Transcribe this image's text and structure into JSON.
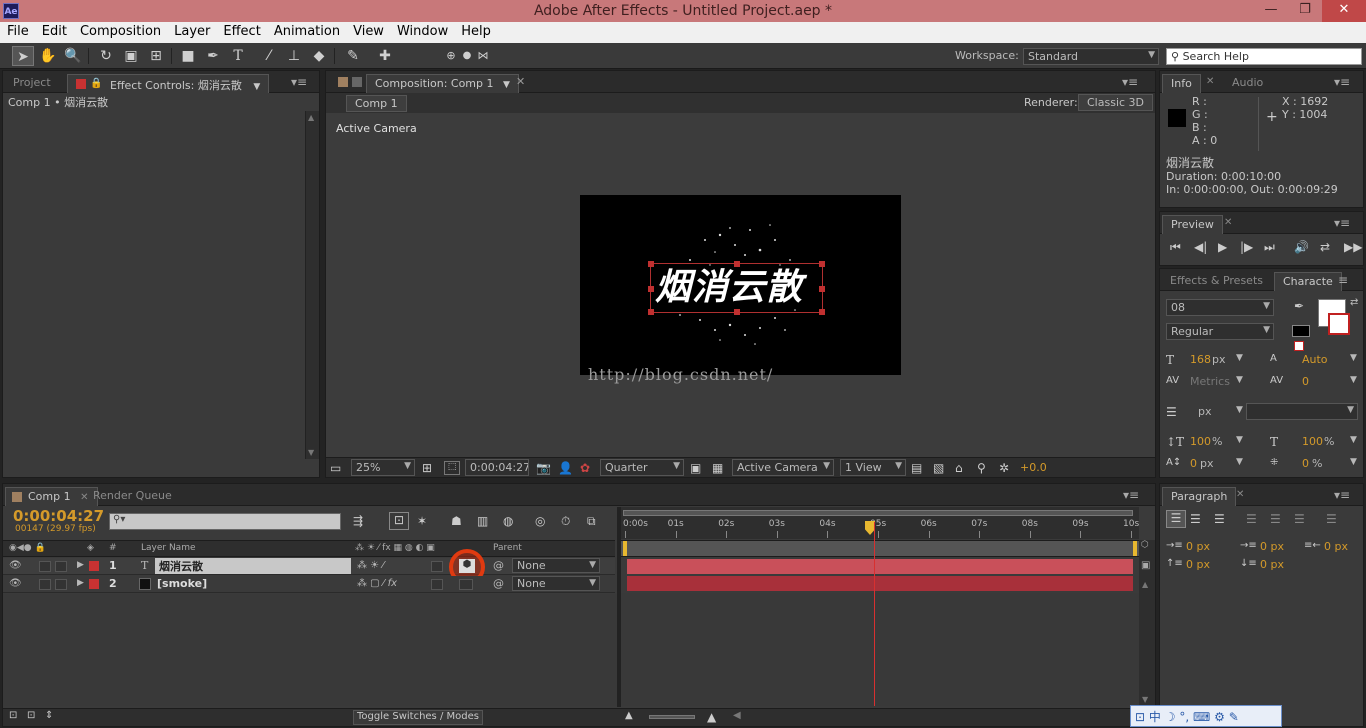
{
  "app": {
    "title": "Adobe After Effects - Untitled Project.aep *",
    "icon": "Ae",
    "min": "—",
    "max": "❐",
    "close": "✕"
  },
  "menu": [
    "File",
    "Edit",
    "Composition",
    "Layer",
    "Effect",
    "Animation",
    "View",
    "Window",
    "Help"
  ],
  "toolbar": {
    "workspace_label": "Workspace:",
    "workspace_value": "Standard",
    "search_placeholder": "Search Help"
  },
  "project_panel": {
    "tab_project": "Project",
    "tab_effect_controls": "Effect Controls: 烟消云散",
    "breadcrumb": "Comp 1 • 烟消云散"
  },
  "comp_panel": {
    "tab": "Composition: Comp 1",
    "comp_button": "Comp 1",
    "renderer_label": "Renderer:",
    "renderer_value": "Classic 3D",
    "view_label": "Active Camera",
    "text_content": "烟消云散",
    "watermark": "http://blog.csdn.net/",
    "zoom": "25%",
    "timecode": "0:00:04:27",
    "resolution": "Quarter",
    "camera": "Active Camera",
    "views": "1 View",
    "exposure": "+0.0"
  },
  "info_panel": {
    "tab_info": "Info",
    "tab_audio": "Audio",
    "r": "R :",
    "g": "G :",
    "b": "B :",
    "a": "A : 0",
    "x": "X : 1692",
    "y": "Y : 1004",
    "layer_name": "烟消云散",
    "duration": "Duration: 0:00:10:00",
    "in_out": "In: 0:00:00:00, Out: 0:00:09:29"
  },
  "preview_panel": {
    "tab": "Preview"
  },
  "character_panel": {
    "tab_effects": "Effects & Presets",
    "tab_character": "Characte",
    "font": "08",
    "style": "Regular",
    "size": "168",
    "size_unit": "px",
    "leading": "Auto",
    "kerning": "Metrics",
    "tracking": "0",
    "stroke_unit": "px",
    "vscale": "100",
    "vscale_unit": "%",
    "hscale": "100",
    "hscale_unit": "%",
    "baseline": "0",
    "baseline_unit": "px",
    "tsume": "0",
    "tsume_unit": "%"
  },
  "paragraph_panel": {
    "tab": "Paragraph",
    "indent_left": "0 px",
    "indent_first": "0 px",
    "indent_right": "0 px",
    "space_before": "0 px",
    "space_after": "0 px"
  },
  "timeline": {
    "tab_comp": "Comp 1",
    "tab_render": "Render Queue",
    "timecode": "0:00:04:27",
    "frame_info": "00147 (29.97 fps)",
    "col_num": "#",
    "col_layer_name": "Layer Name",
    "col_parent": "Parent",
    "toggle_label": "Toggle Switches / Modes",
    "ticks": [
      "0:00s",
      "01s",
      "02s",
      "03s",
      "04s",
      "05s",
      "06s",
      "07s",
      "08s",
      "09s",
      "10s"
    ],
    "layers": [
      {
        "num": "1",
        "type": "T",
        "name": "烟消云散",
        "parent": "None",
        "color": "#c83232"
      },
      {
        "num": "2",
        "type": "",
        "name": "[smoke]",
        "parent": "None",
        "color": "#c83232"
      }
    ]
  },
  "ime": {
    "label": "中"
  }
}
